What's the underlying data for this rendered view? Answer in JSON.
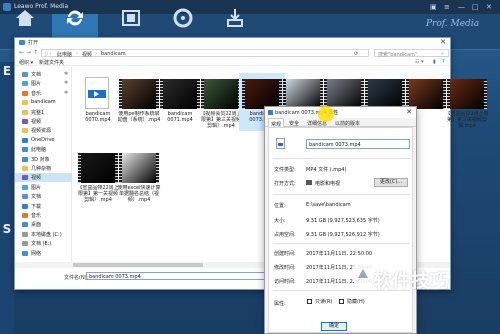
{
  "app": {
    "title": "Leawo Prof. Media",
    "window_controls": [
      "▣",
      "≡",
      "—",
      "□",
      "✕"
    ],
    "watermark": "Prof. Media",
    "side_letters": [
      "E",
      "S"
    ]
  },
  "dialog": {
    "title": "打开",
    "breadcrumb": [
      "此电脑",
      "视频",
      "bandicam"
    ],
    "search_placeholder": "搜索\"bandicam\"",
    "toolbar": [
      "组织 ▾",
      "新建文件夹"
    ],
    "nav_items": [
      {
        "label": "文档",
        "color": "#5a8fd6",
        "pinned": true
      },
      {
        "label": "图片",
        "color": "#4aa3df",
        "pinned": true
      },
      {
        "label": "音乐",
        "color": "#e07a2b",
        "pinned": true
      },
      {
        "label": "bandicam",
        "color": "#f0c24a",
        "pinned": false
      },
      {
        "label": "完整1",
        "color": "#f0c24a",
        "pinned": false
      },
      {
        "label": "视频",
        "color": "#6a5acd",
        "pinned": false
      },
      {
        "label": "视频资源",
        "color": "#f0c24a",
        "pinned": false
      },
      {
        "label": "OneDrive",
        "color": "#2f7fd6",
        "pinned": false
      },
      {
        "label": "此电脑",
        "color": "#3f8ed8",
        "pinned": false
      },
      {
        "label": "3D 对象",
        "color": "#3f8ed8",
        "pinned": false
      },
      {
        "label": "几种杂物",
        "color": "#f0c24a",
        "pinned": false
      },
      {
        "label": "视频",
        "color": "#6a5acd",
        "pinned": false,
        "selected": true
      },
      {
        "label": "图片",
        "color": "#4aa3df",
        "pinned": false
      },
      {
        "label": "文档",
        "color": "#5a8fd6",
        "pinned": false
      },
      {
        "label": "下载",
        "color": "#2f7fd6",
        "pinned": false
      },
      {
        "label": "音乐",
        "color": "#e07a2b",
        "pinned": false
      },
      {
        "label": "桌面",
        "color": "#3f8ed8",
        "pinned": false
      },
      {
        "label": "本地磁盘 (C:)",
        "color": "#999999",
        "pinned": false
      },
      {
        "label": "文档 (E:)",
        "color": "#999999",
        "pinned": false
      },
      {
        "label": "网络",
        "color": "#3f8ed8",
        "pinned": false
      }
    ],
    "files_row1": [
      {
        "label": "bandicam 0070.mp4",
        "kind": "doc"
      },
      {
        "label": "使用pe制作系统启动盘（系统）.mp4",
        "kind": "video",
        "tone": "#5a4030"
      },
      {
        "label": "bandicam 0071.mp4",
        "kind": "video",
        "tone": "#2b2b2b"
      },
      {
        "label": "【视频会员22周上限第】第三关视频剪辑）.mp4",
        "kind": "video",
        "tone": "#3a5a3a"
      },
      {
        "label": "bandicam 0073.mp4",
        "kind": "video",
        "tone": "#4a1a10",
        "selected": true
      },
      {
        "label": "",
        "kind": "video",
        "tone": "#cfd8e0"
      },
      {
        "label": "",
        "kind": "video",
        "tone": "#7a7f8a"
      },
      {
        "label": "",
        "kind": "video",
        "tone": "#2a3a4a"
      },
      {
        "label": "",
        "kind": "video",
        "tone": "#7a3a20"
      },
      {
        "label": "【宣益品]22周上限第】第三关视频剪辑.mp4",
        "kind": "video",
        "tone": "#6a2a10"
      }
    ],
    "files_row2": [
      {
        "label": "【宣益品物22周上限第】第一关视频剪辑）.mp4",
        "kind": "video",
        "tone": "#1a1a1a"
      },
      {
        "label": "使用excel快速计算单据翻名总结（视频）.mp4",
        "kind": "video",
        "tone": "#e8e8e8"
      }
    ],
    "filename_label": "文件名(N):",
    "filename_value": "bandicam 0073.mp4"
  },
  "props": {
    "title": "bandicam 0073.mp4 属性",
    "tabs": [
      "常规",
      "安全",
      "详细信息",
      "以前的版本"
    ],
    "name_value": "bandicam 0073.mp4",
    "rows": [
      {
        "label": "文件类型:",
        "value": "MP4 文件 (.mp4)"
      },
      {
        "label": "打开方式:",
        "value": "电影和电视"
      },
      {
        "label": "位置:",
        "value": "E:\\save\\bandicam"
      },
      {
        "label": "大小:",
        "value": "9.31 GB (9,927,523,635 字节)"
      },
      {
        "label": "占用空间:",
        "value": "9.31 GB (9,927,526,912 字节)"
      },
      {
        "label": "创建时间:",
        "value": "2017年11月11日, 22:50:00"
      },
      {
        "label": "修改时间:",
        "value": "2017年11月11日, 23:04:47"
      },
      {
        "label": "访问时间:",
        "value": "2017年11月11日, 22:50:00"
      },
      {
        "label": "属性:",
        "value": ""
      }
    ],
    "change_button": "更改(C)...",
    "checkbox_readonly": "只读(R)",
    "checkbox_hidden": "隐藏(H)",
    "ok_button": "确定"
  },
  "site_watermark": "软件技巧"
}
